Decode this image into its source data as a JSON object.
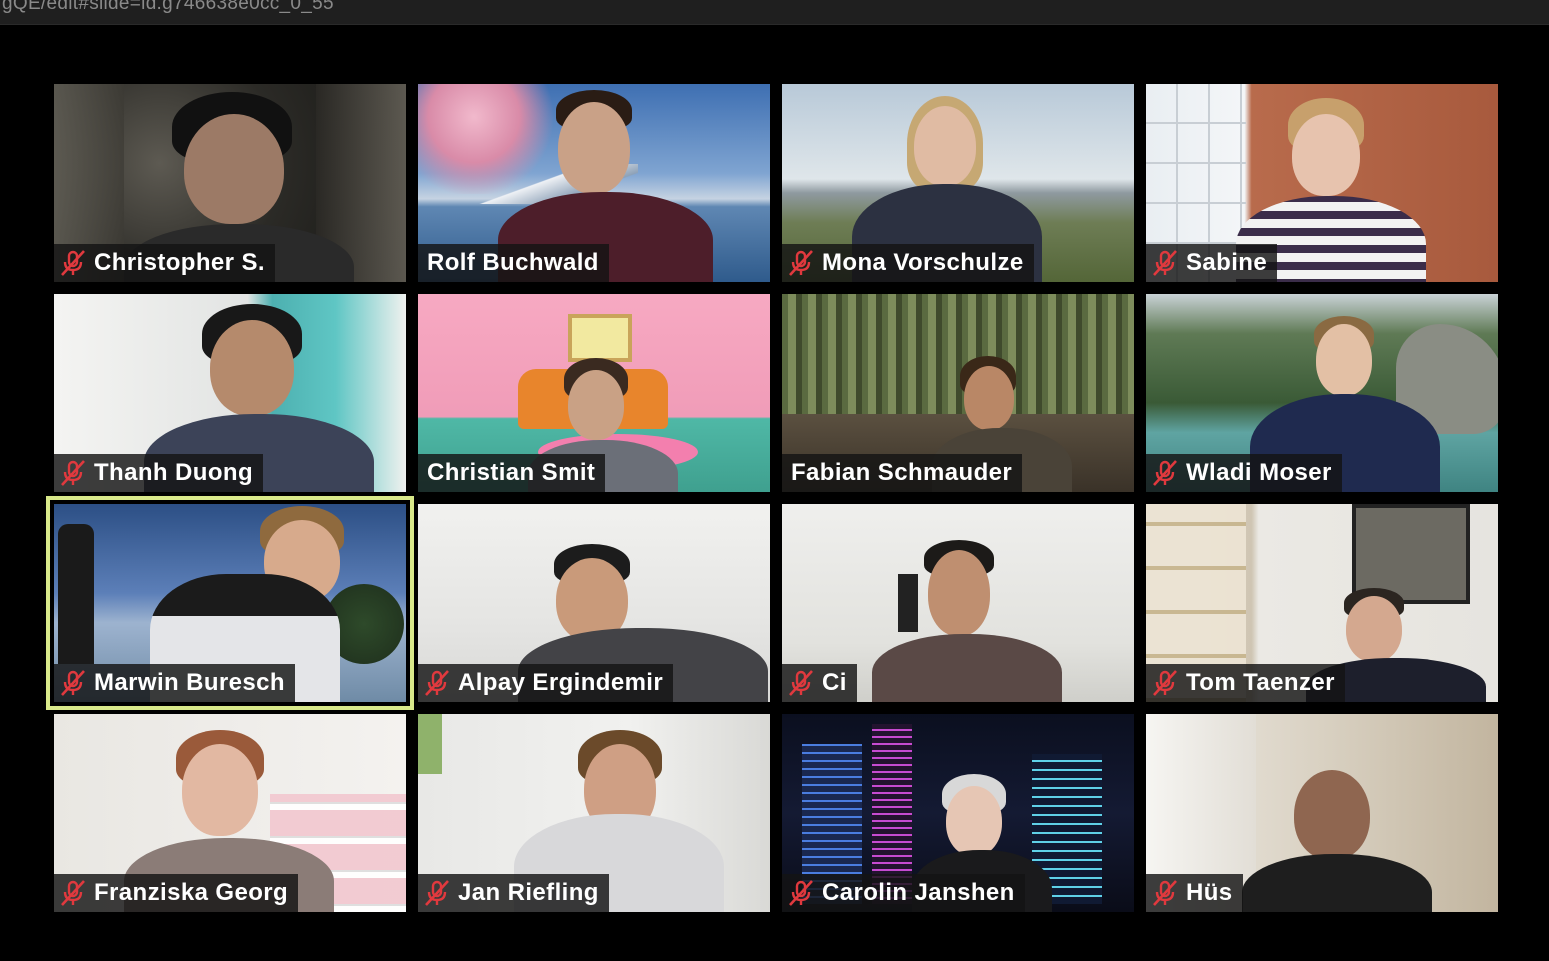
{
  "browser": {
    "url_fragment": "gQE/edit#slide=id.g746638e0cc_0_55"
  },
  "meeting": {
    "participants": [
      {
        "name": "Christopher S.",
        "muted": true
      },
      {
        "name": "Rolf Buchwald",
        "muted": false
      },
      {
        "name": "Mona Vorschulze",
        "muted": true
      },
      {
        "name": "Sabine",
        "muted": true
      },
      {
        "name": "Thanh Duong",
        "muted": true
      },
      {
        "name": "Christian Smit",
        "muted": false
      },
      {
        "name": "Fabian Schmauder",
        "muted": false
      },
      {
        "name": "Wladi Moser",
        "muted": true
      },
      {
        "name": "Marwin Buresch",
        "muted": true,
        "active_speaker": true
      },
      {
        "name": "Alpay Ergindemir",
        "muted": true
      },
      {
        "name": "Ci",
        "muted": true
      },
      {
        "name": "Tom Taenzer",
        "muted": true
      },
      {
        "name": "Franziska Georg",
        "muted": true
      },
      {
        "name": "Jan Riefling",
        "muted": true
      },
      {
        "name": "Carolin Janshen",
        "muted": true
      },
      {
        "name": "Hüs",
        "muted": true
      }
    ],
    "colors": {
      "active_border": "#d9e98a",
      "muted_icon": "#e0393e",
      "name_bg": "#141414"
    }
  }
}
